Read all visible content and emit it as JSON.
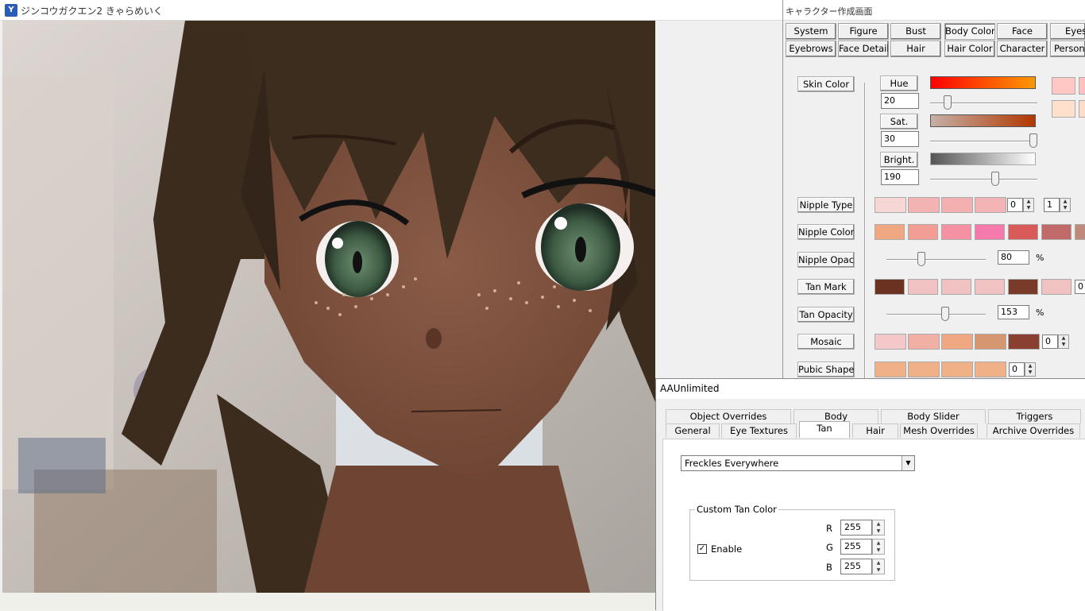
{
  "game_window": {
    "title": "ジンコウガクエン2 きゃらめいく",
    "icon": "app-logo-icon"
  },
  "char_maker": {
    "title": "キャラクター作成画面",
    "tabs_row1": [
      "System",
      "Figure",
      "Bust",
      "Body Color",
      "Face",
      "Eyes"
    ],
    "tabs_row2": [
      "Eyebrows",
      "Face Details",
      "Hair",
      "Hair Color",
      "Character",
      "Personality"
    ],
    "active_tab": "Body Color",
    "skin_color": {
      "label": "Skin Color",
      "hue_label": "Hue",
      "hue_value": "20",
      "hue_level": 0.1,
      "sat_label": "Sat.",
      "sat_value": "30",
      "sat_level": 1.0,
      "bright_label": "Bright.",
      "bright_value": "190",
      "bright_level": 0.6
    },
    "nipple_type": {
      "label": "Nipple Type",
      "spin1": "0",
      "spin2": "1"
    },
    "nipple_color": {
      "label": "Nipple Color"
    },
    "nipple_opacity": {
      "label": "Nipple Opacity",
      "value": "80",
      "unit": "%",
      "level": 0.34
    },
    "tan_mark": {
      "label": "Tan Mark",
      "spin": "0"
    },
    "tan_opacity": {
      "label": "Tan Opacity",
      "value": "153",
      "unit": "%",
      "level": 0.6
    },
    "mosaic": {
      "label": "Mosaic",
      "spin": "0"
    },
    "pubic_shape": {
      "label": "Pubic Shape",
      "spin": "0"
    }
  },
  "aau": {
    "title": "AAUnlimited",
    "tabs_row1": [
      "Object Overrides",
      "Body",
      "Body Slider",
      "Triggers"
    ],
    "tabs_row2": [
      "General",
      "Eye Textures",
      "Tan",
      "Hair",
      "Mesh Overrides",
      "Archive Overrides"
    ],
    "active_tab": "Tan",
    "tan_select_value": "Freckles Everywhere",
    "custom_tan_label": "Custom Tan Color",
    "enable_label": "Enable",
    "enable_checked": true,
    "r_label": "R",
    "r_value": "255",
    "g_label": "G",
    "g_value": "255",
    "b_label": "B",
    "b_value": "255"
  }
}
